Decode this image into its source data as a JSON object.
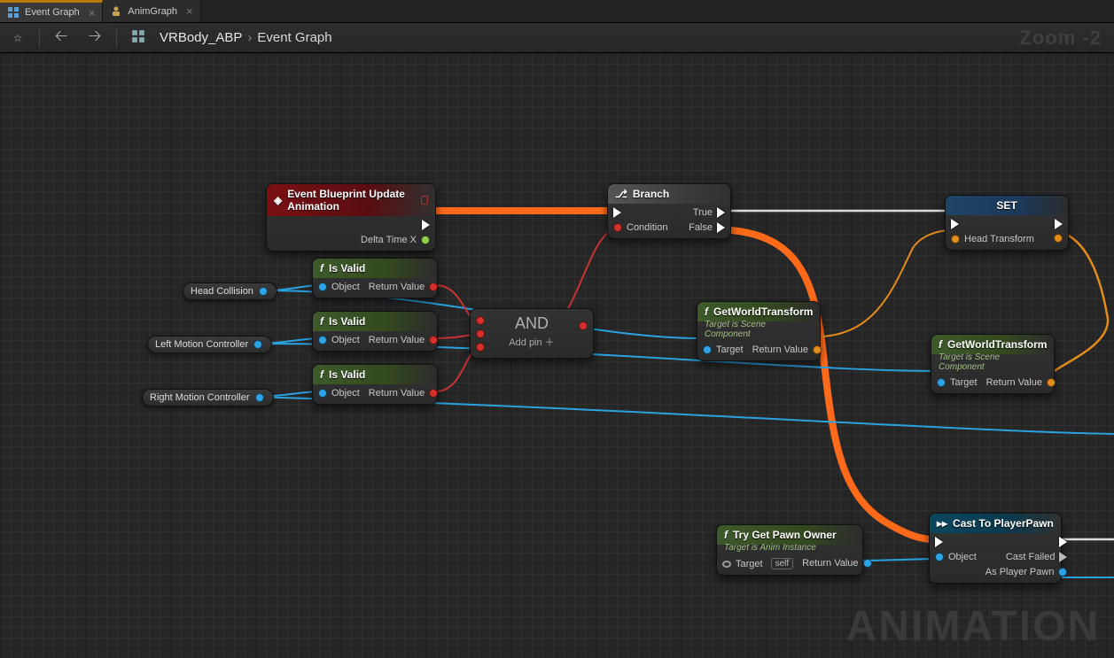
{
  "tabs": [
    {
      "label": "Event Graph",
      "active": true,
      "icon": "graph-grid-icon"
    },
    {
      "label": "AnimGraph",
      "active": false,
      "icon": "pawn-icon"
    }
  ],
  "toolbar": {
    "favorite_tooltip": "Favorite",
    "back_tooltip": "Back",
    "forward_tooltip": "Forward"
  },
  "breadcrumb": {
    "parent": "VRBody_ABP",
    "separator": "›",
    "current": "Event Graph"
  },
  "zoom_label": "Zoom -2",
  "watermark": "ANIMATION",
  "labels": {
    "object": "Object",
    "return_value": "Return Value",
    "target": "Target",
    "condition": "Condition",
    "true": "True",
    "false": "False",
    "add_pin": "Add pin ＋",
    "target_self": "self",
    "cast_failed": "Cast Failed",
    "as_player_pawn": "As Player Pawn",
    "delta_time_x": "Delta Time X",
    "head_transform": "Head Transform",
    "and": "AND"
  },
  "pills": {
    "head_collision": "Head Collision",
    "left_motion_controller": "Left Motion Controller",
    "right_motion_controller": "Right Motion Controller"
  },
  "subtitles": {
    "scene_component": "Target is Scene Component",
    "anim_instance": "Target is Anim Instance"
  },
  "nodes": {
    "event": {
      "title": "Event Blueprint Update Animation"
    },
    "is_valid": {
      "title": "Is Valid"
    },
    "branch": {
      "title": "Branch"
    },
    "get_world_transform": {
      "title": "GetWorldTransform"
    },
    "set": {
      "title": "SET"
    },
    "cast": {
      "title": "Cast To PlayerPawn"
    },
    "try_get_pawn_owner": {
      "title": "Try Get Pawn Owner"
    }
  }
}
